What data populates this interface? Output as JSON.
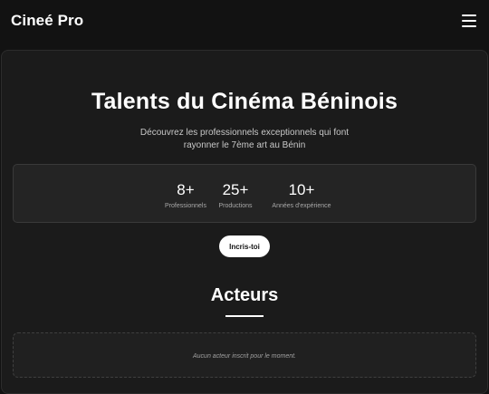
{
  "header": {
    "brand": "Cineé Pro",
    "menu_icon": "hamburger-menu-icon"
  },
  "hero": {
    "title": "Talents du Cinéma Béninois",
    "subtitle_line1": "Découvrez les professionnels exceptionnels qui font",
    "subtitle_line2": "rayonner le 7ème art au Bénin"
  },
  "stats": [
    {
      "value": "8+",
      "label": "Professionnels"
    },
    {
      "value": "25+",
      "label": "Productions"
    },
    {
      "value": "10+",
      "label": "Années d'expérience"
    }
  ],
  "cta": {
    "label": "Incris-toi"
  },
  "section": {
    "title": "Acteurs",
    "empty_message": "Aucun acteur inscrit pour le moment."
  },
  "colors": {
    "background": "#121212",
    "card": "#1b1b1b",
    "stats_panel": "#242424",
    "accent": "#ffffff"
  }
}
